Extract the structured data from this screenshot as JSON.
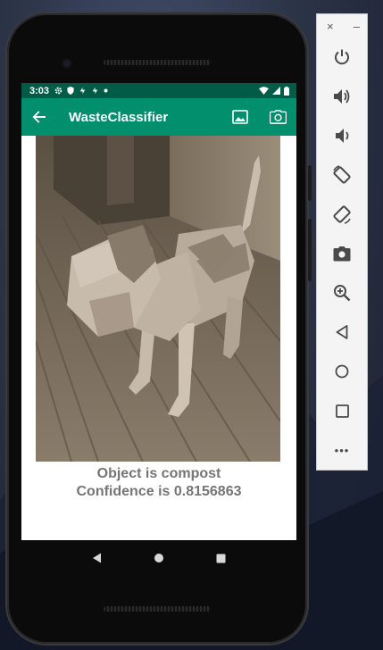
{
  "status_bar": {
    "time": "3:03",
    "left_icons": [
      "gear-icon",
      "shield-icon",
      "sync-icon",
      "sync-icon",
      "dot-icon"
    ],
    "right_icons": [
      "wifi-icon",
      "signal-icon",
      "battery-icon"
    ]
  },
  "app_bar": {
    "title": "WasteClassifier",
    "back_icon": "back-arrow-icon",
    "actions": [
      "gallery-icon",
      "camera-icon"
    ],
    "color": "#018f6e",
    "status_color": "#005c47"
  },
  "result": {
    "line1": "Object is compost",
    "line2": "Confidence is 0.8156863"
  },
  "nav_bar": {
    "buttons": [
      "back-triangle-icon",
      "home-circle-icon",
      "recents-square-icon"
    ]
  },
  "emulator_toolbar": {
    "window_controls": {
      "close": "×",
      "minimize": "–"
    },
    "buttons": [
      "power-icon",
      "volume-up-icon",
      "volume-down-icon",
      "rotate-left-icon",
      "rotate-right-icon",
      "screenshot-icon",
      "zoom-icon",
      "back-icon",
      "home-icon",
      "overview-icon",
      "more-icon"
    ],
    "more_label": "•••"
  }
}
